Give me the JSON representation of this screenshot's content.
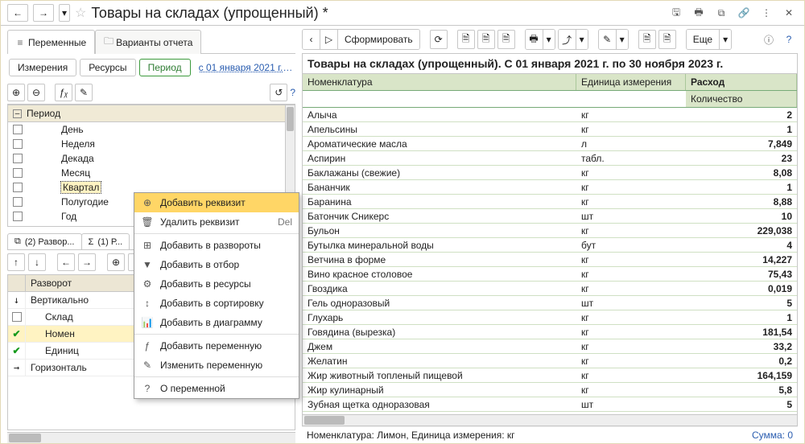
{
  "titlebar": {
    "title": "Товары на складах (упрощенный) *"
  },
  "tabs": {
    "vars": "Переменные",
    "variants": "Варианты отчета"
  },
  "sub": {
    "measures": "Измерения",
    "resources": "Ресурсы",
    "period": "Период",
    "link": "с 01 января 2021 г. по ..."
  },
  "toolbar": {
    "fx": "ƒᵪ",
    "help": "?"
  },
  "tree": {
    "root": "Период",
    "items": [
      "День",
      "Неделя",
      "Декада",
      "Месяц",
      "Квартал",
      "Полугодие",
      "Год"
    ],
    "selected_index": 4
  },
  "context_menu": {
    "items": [
      {
        "icon": "⊕",
        "label": "Добавить реквизит",
        "hot": true
      },
      {
        "icon": "🗑",
        "label": "Удалить реквизит",
        "shortcut": "Del"
      },
      {
        "sep": true
      },
      {
        "icon": "⊞",
        "label": "Добавить в развороты"
      },
      {
        "icon": "▼",
        "label": "Добавить в отбор"
      },
      {
        "icon": "⚙",
        "label": "Добавить в ресурсы"
      },
      {
        "icon": "↕",
        "label": "Добавить в сортировку"
      },
      {
        "icon": "📊",
        "label": "Добавить в диаграмму"
      },
      {
        "sep": true
      },
      {
        "icon": "ƒ",
        "label": "Добавить переменную"
      },
      {
        "icon": "✎",
        "label": "Изменить переменную"
      },
      {
        "sep": true
      },
      {
        "icon": "?",
        "label": "О переменной"
      }
    ]
  },
  "lowtabs": {
    "a": "(2) Развор...",
    "b": "(1) Р..."
  },
  "pivot": {
    "header": "Разворот",
    "rows": [
      {
        "arrow": "↓",
        "label": "Вертикально"
      },
      {
        "arrow": "",
        "label": "Склад",
        "chk": false,
        "indent": 1
      },
      {
        "arrow": "",
        "label": "Номен",
        "chk": true,
        "indent": 1,
        "hl": true
      },
      {
        "arrow": "",
        "label": "Единиц",
        "chk": true,
        "indent": 1
      },
      {
        "arrow": "→",
        "label": "Горизонталь"
      }
    ]
  },
  "right": {
    "form_btn": "Сформировать",
    "more": "Еще",
    "help": "?",
    "circle_help": "ⓘ"
  },
  "report": {
    "title": "Товары на складах (упрощенный). С 01 января 2021 г. по 30 ноября 2023 г.",
    "col1": "Номенклатура",
    "col2": "Единица измерения",
    "col3": "Расход",
    "col3b": "Количество",
    "rows": [
      [
        "Алыча",
        "кг",
        "2"
      ],
      [
        "Апельсины",
        "кг",
        "1"
      ],
      [
        "Ароматические масла",
        "л",
        "7,849"
      ],
      [
        "Аспирин",
        "табл.",
        "23"
      ],
      [
        "Баклажаны (свежие)",
        "кг",
        "8,08"
      ],
      [
        "Бананчик",
        "кг",
        "1"
      ],
      [
        "Баранина",
        "кг",
        "8,88"
      ],
      [
        "Батончик Сникерс",
        "шт",
        "10"
      ],
      [
        "Бульон",
        "кг",
        "229,038"
      ],
      [
        "Бутылка минеральной воды",
        "бут",
        "4"
      ],
      [
        "Ветчина в форме",
        "кг",
        "14,227"
      ],
      [
        "Вино красное столовое",
        "кг",
        "75,43"
      ],
      [
        "Гвоздика",
        "кг",
        "0,019"
      ],
      [
        "Гель одноразовый",
        "шт",
        "5"
      ],
      [
        "Глухарь",
        "кг",
        "1"
      ],
      [
        "Говядина (вырезка)",
        "кг",
        "181,54"
      ],
      [
        "Джем",
        "кг",
        "33,2"
      ],
      [
        "Желатин",
        "кг",
        "0,2"
      ],
      [
        "Жир животный топленый пищевой",
        "кг",
        "164,159"
      ],
      [
        "Жир кулинарный",
        "кг",
        "5,8"
      ],
      [
        "Зубная щетка одноразовая",
        "шт",
        "5"
      ]
    ]
  },
  "footer": {
    "left": "Номенклатура: Лимон, Единица измерения: кг",
    "right": "Сумма: 0"
  }
}
